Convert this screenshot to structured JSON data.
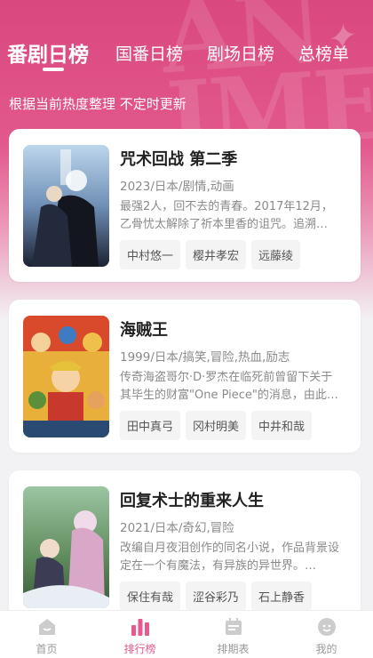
{
  "tabs": [
    {
      "label": "番剧日榜",
      "active": true
    },
    {
      "label": "国番日榜",
      "active": false
    },
    {
      "label": "剧场日榜",
      "active": false
    },
    {
      "label": "总榜单",
      "active": false
    }
  ],
  "subtitle": "根据当前热度整理 不定时更新",
  "items": [
    {
      "title": "咒术回战 第二季",
      "meta": "2023/日本/剧情,动画",
      "desc": "最强2人，回不去的青春。2017年12月，乙骨忧太解除了祈本里香的诅咒。追溯…",
      "cast": [
        "中村悠一",
        "樱井孝宏",
        "远藤绫"
      ]
    },
    {
      "title": "海贼王",
      "meta": "1999/日本/搞笑,冒险,热血,励志",
      "desc": "传奇海盗哥尔·D·罗杰在临死前曾留下关于其毕生的财富\"One Piece\"的消息，由此…",
      "cast": [
        "田中真弓",
        "冈村明美",
        "中井和哉"
      ]
    },
    {
      "title": "回复术士的重来人生",
      "meta": "2021/日本/奇幻,冒险",
      "desc": "改编自月夜泪创作的同名小说，作品背景设定在一个有魔法，有异族的异世界。…",
      "cast": [
        "保住有哉",
        "涩谷彩乃",
        "石上静香"
      ]
    }
  ],
  "bottom_nav": [
    {
      "label": "首页",
      "icon": "home-icon",
      "active": false
    },
    {
      "label": "排行榜",
      "icon": "ranking-icon",
      "active": true
    },
    {
      "label": "排期表",
      "icon": "calendar-icon",
      "active": false
    },
    {
      "label": "我的",
      "icon": "profile-icon",
      "active": false
    }
  ],
  "colors": {
    "accent": "#e8598f",
    "hero_top": "#d9487f",
    "inactive_nav": "#999999"
  }
}
